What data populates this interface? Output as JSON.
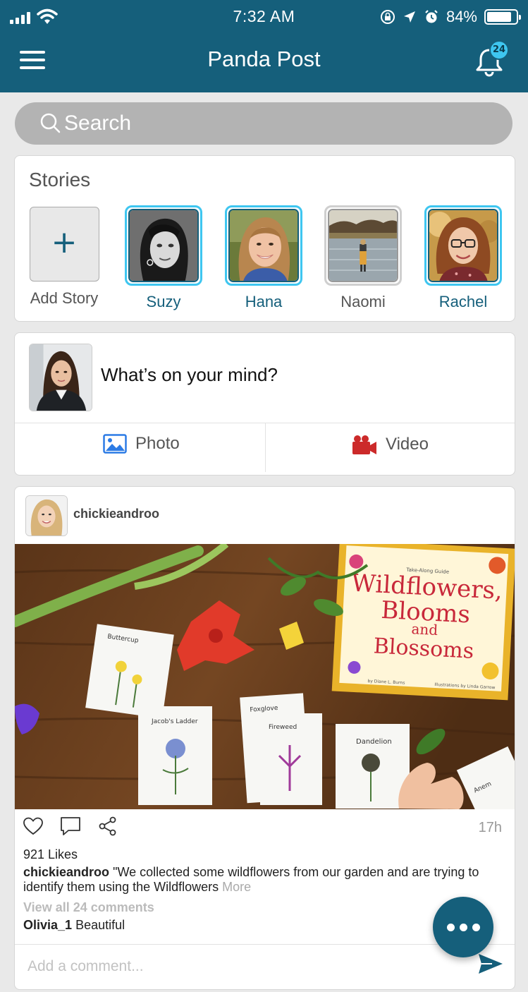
{
  "status_bar": {
    "time": "7:32 AM",
    "battery": "84%",
    "battery_level": 0.84
  },
  "header": {
    "title": "Panda Post",
    "notification_count": "24",
    "colors": {
      "header_bg": "#155f7b",
      "badge_bg": "#3ec6f0"
    }
  },
  "search": {
    "placeholder": "Search"
  },
  "stories": {
    "title": "Stories",
    "add_label": "Add Story",
    "add_symbol": "+",
    "items": [
      {
        "name": "Suzy",
        "seen": false
      },
      {
        "name": "Hana",
        "seen": false
      },
      {
        "name": "Naomi",
        "seen": true
      },
      {
        "name": "Rachel",
        "seen": false
      }
    ]
  },
  "composer": {
    "prompt": "What’s on your mind?",
    "photo_label": "Photo",
    "video_label": "Video"
  },
  "post": {
    "username": "chickieandroo",
    "time": "17h",
    "likes": "921 Likes",
    "caption_user": "chickieandroo",
    "caption_text": "\"We collected some wildflowers from our garden and are trying to identify them using the Wildflowers",
    "more_label": "More",
    "view_comments": "View all 24 comments",
    "comment_user": "Olivia_1",
    "comment_text": "Beautiful",
    "comment_placeholder": "Add a comment...",
    "image": {
      "book_title_lines": [
        "Wildflowers,",
        "Blooms",
        "and",
        "Blossoms"
      ],
      "book_small_top": "Take-Along Guide",
      "book_author": "by Diane L. Burns",
      "book_illustrator": "Illustrations by Linda Garrow",
      "card_labels": [
        "Buttercup",
        "Jacob's Ladder",
        "Foxglove",
        "Fireweed",
        "Dandelion",
        "Anem"
      ]
    }
  }
}
